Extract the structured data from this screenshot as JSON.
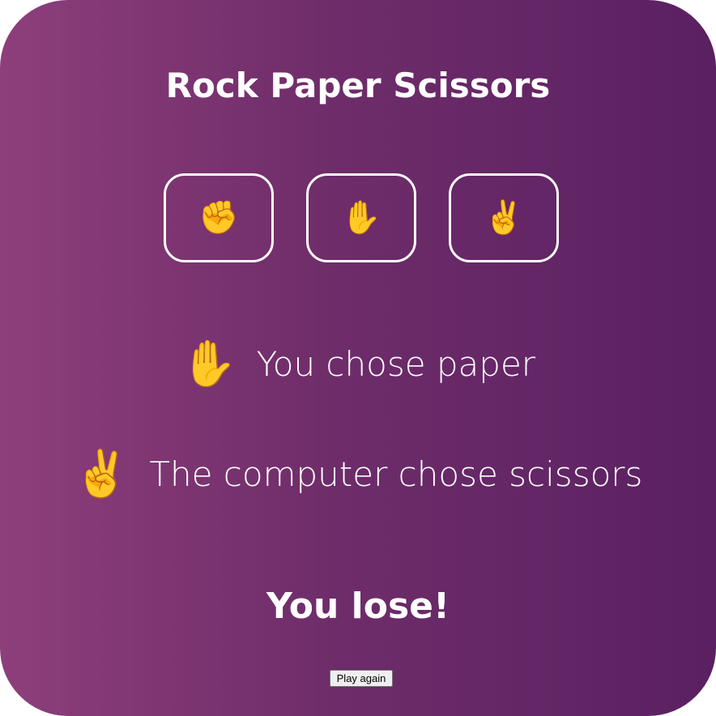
{
  "game": {
    "title": "Rock Paper Scissors",
    "choices": [
      {
        "name": "rock",
        "glyph": "✊"
      },
      {
        "name": "paper",
        "glyph": "✋"
      },
      {
        "name": "scissors",
        "glyph": "✌️"
      }
    ],
    "player": {
      "glyph": "✋",
      "text": "You chose paper"
    },
    "computer": {
      "glyph": "✌️",
      "text": "The computer chose scissors"
    },
    "outcome": "You lose!",
    "play_again_label": "Play again"
  },
  "theme": {
    "gradient_start": "#8d3f7b",
    "gradient_end": "#5a2062",
    "text_color": "#ffffff"
  }
}
